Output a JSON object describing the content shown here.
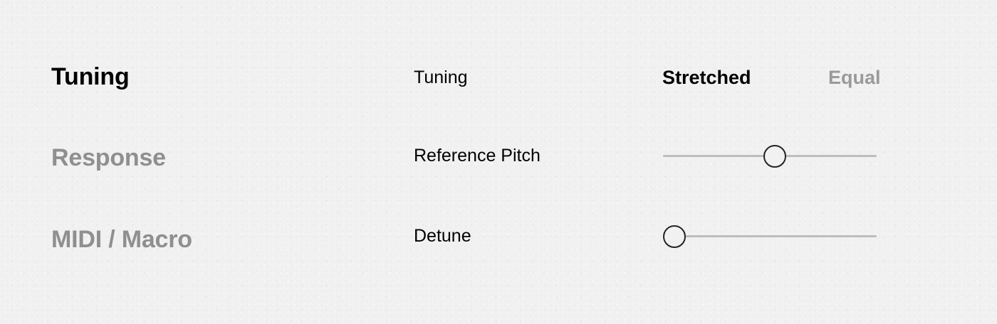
{
  "nav": {
    "items": [
      {
        "label": "Tuning",
        "active": true
      },
      {
        "label": "Response",
        "active": false
      },
      {
        "label": "MIDI / Macro",
        "active": false
      }
    ]
  },
  "settings": {
    "tuning": {
      "label": "Tuning",
      "options": [
        "Stretched",
        "Equal"
      ],
      "selected": "Stretched"
    },
    "reference_pitch": {
      "label": "Reference Pitch",
      "value_fraction": 0.52
    },
    "detune": {
      "label": "Detune",
      "value_fraction": 0.05
    }
  },
  "colors": {
    "active_text": "#000000",
    "inactive_text": "#8f8f8f",
    "track": "#bdbdbd",
    "thumb_border": "#222222",
    "background": "#f1f1f1"
  }
}
